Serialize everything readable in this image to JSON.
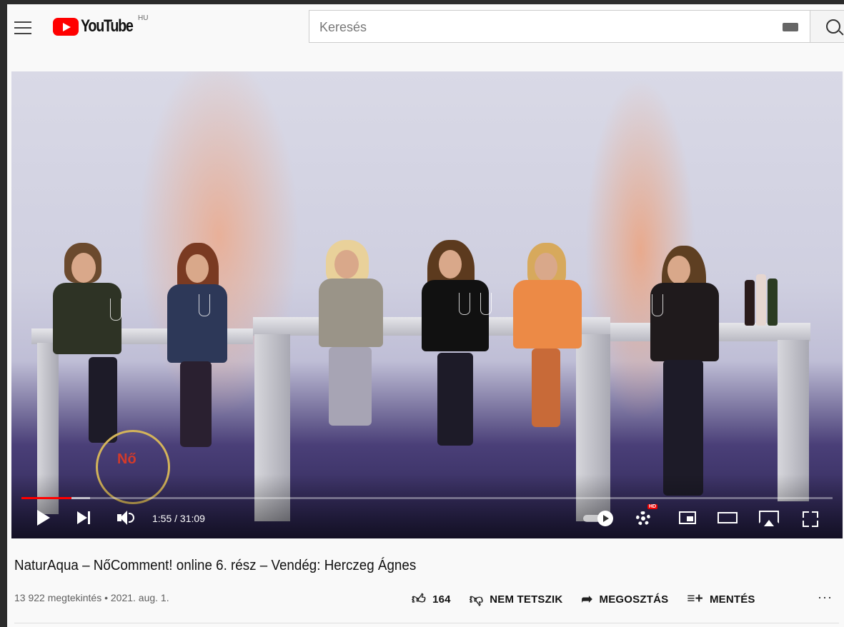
{
  "header": {
    "logo_text": "YouTube",
    "country_code": "HU",
    "search_placeholder": "Keresés"
  },
  "player": {
    "current_time": "1:55",
    "duration": "31:09",
    "time_display": "1:55 / 31:09",
    "played_fraction": 0.062,
    "loaded_fraction": 0.085,
    "watermark_text": "Nő",
    "quality_badge": "HD",
    "progress_color": "#ff0000"
  },
  "video": {
    "title": "NaturAqua – NőComment! online 6. rész – Vendég: Herczeg Ágnes",
    "views": "13 922 megtekintés",
    "date": "2021. aug. 1.",
    "meta_line": "13 922 megtekintés • 2021. aug. 1."
  },
  "actions": {
    "like_count": "164",
    "dislike_label": "NEM TETSZIK",
    "share_label": "MEGOSZTÁS",
    "save_label": "MENTÉS",
    "more_label": "···"
  },
  "colors": {
    "brand_red": "#ff0000",
    "page_bg": "#f9f9f9",
    "watermark_ring": "#d4b45a"
  }
}
